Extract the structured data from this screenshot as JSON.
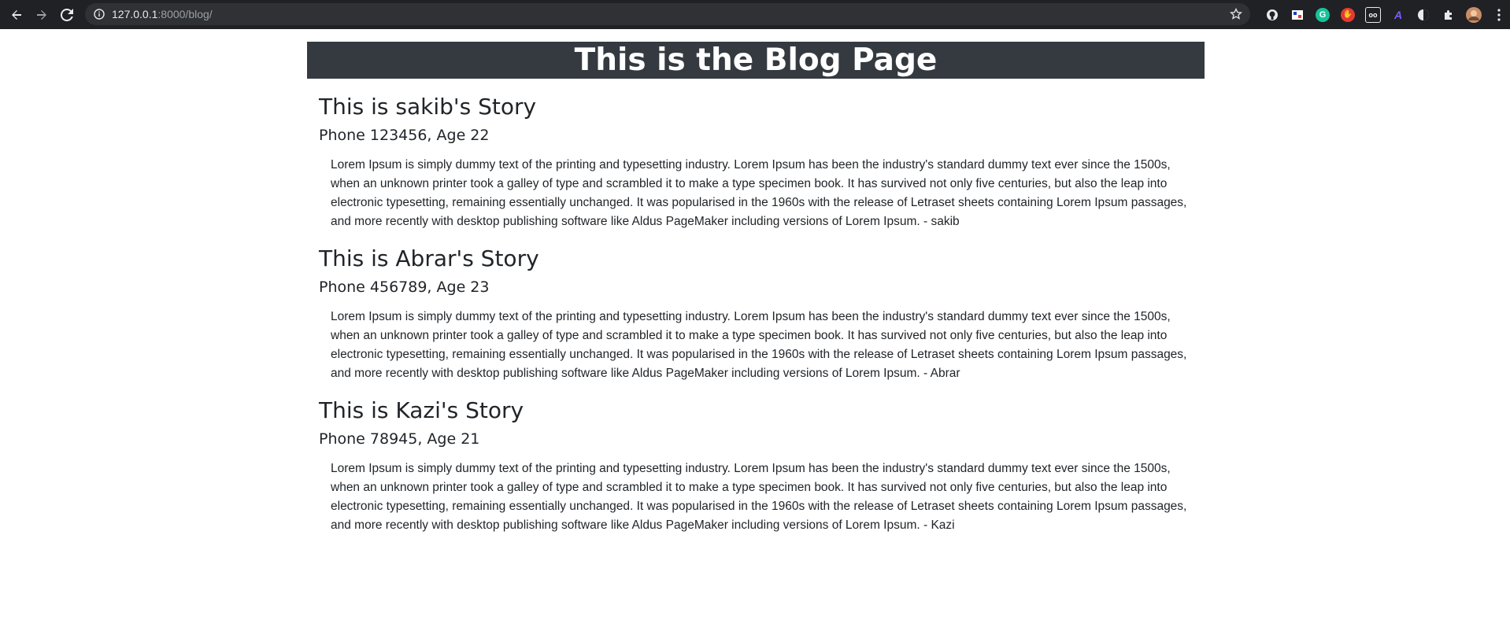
{
  "browser": {
    "url_host": "127.0.0.1",
    "url_path": ":8000/blog/",
    "extensions": [
      {
        "name": "github-extension-icon",
        "glyph": "",
        "bg": "#202124"
      },
      {
        "name": "flag-extension-icon",
        "glyph": "",
        "bg": "#ffffff"
      },
      {
        "name": "grammarly-extension-icon",
        "glyph": "G",
        "bg": "#15c39a"
      },
      {
        "name": "hand-extension-icon",
        "glyph": "✋",
        "bg": "#e53935"
      },
      {
        "name": "glasses-extension-icon",
        "glyph": "oo",
        "bg": "#202124"
      },
      {
        "name": "font-extension-icon",
        "glyph": "A",
        "bg": "#202124"
      },
      {
        "name": "circle-extension-icon",
        "glyph": "",
        "bg": "#ffffff"
      },
      {
        "name": "puzzle-extension-icon",
        "glyph": "",
        "bg": "#202124"
      }
    ]
  },
  "page": {
    "header": "This is the Blog Page",
    "stories": [
      {
        "title": "This is sakib's Story",
        "meta": "Phone 123456, Age 22",
        "text": "Lorem Ipsum is simply dummy text of the printing and typesetting industry. Lorem Ipsum has been the industry's standard dummy text ever since the 1500s, when an unknown printer took a galley of type and scrambled it to make a type specimen book. It has survived not only five centuries, but also the leap into electronic typesetting, remaining essentially unchanged. It was popularised in the 1960s with the release of Letraset sheets containing Lorem Ipsum passages, and more recently with desktop publishing software like Aldus PageMaker including versions of Lorem Ipsum. - sakib"
      },
      {
        "title": "This is Abrar's Story",
        "meta": "Phone 456789, Age 23",
        "text": "Lorem Ipsum is simply dummy text of the printing and typesetting industry. Lorem Ipsum has been the industry's standard dummy text ever since the 1500s, when an unknown printer took a galley of type and scrambled it to make a type specimen book. It has survived not only five centuries, but also the leap into electronic typesetting, remaining essentially unchanged. It was popularised in the 1960s with the release of Letraset sheets containing Lorem Ipsum passages, and more recently with desktop publishing software like Aldus PageMaker including versions of Lorem Ipsum. - Abrar"
      },
      {
        "title": "This is Kazi's Story",
        "meta": "Phone 78945, Age 21",
        "text": "Lorem Ipsum is simply dummy text of the printing and typesetting industry. Lorem Ipsum has been the industry's standard dummy text ever since the 1500s, when an unknown printer took a galley of type and scrambled it to make a type specimen book. It has survived not only five centuries, but also the leap into electronic typesetting, remaining essentially unchanged. It was popularised in the 1960s with the release of Letraset sheets containing Lorem Ipsum passages, and more recently with desktop publishing software like Aldus PageMaker including versions of Lorem Ipsum. - Kazi"
      }
    ]
  }
}
